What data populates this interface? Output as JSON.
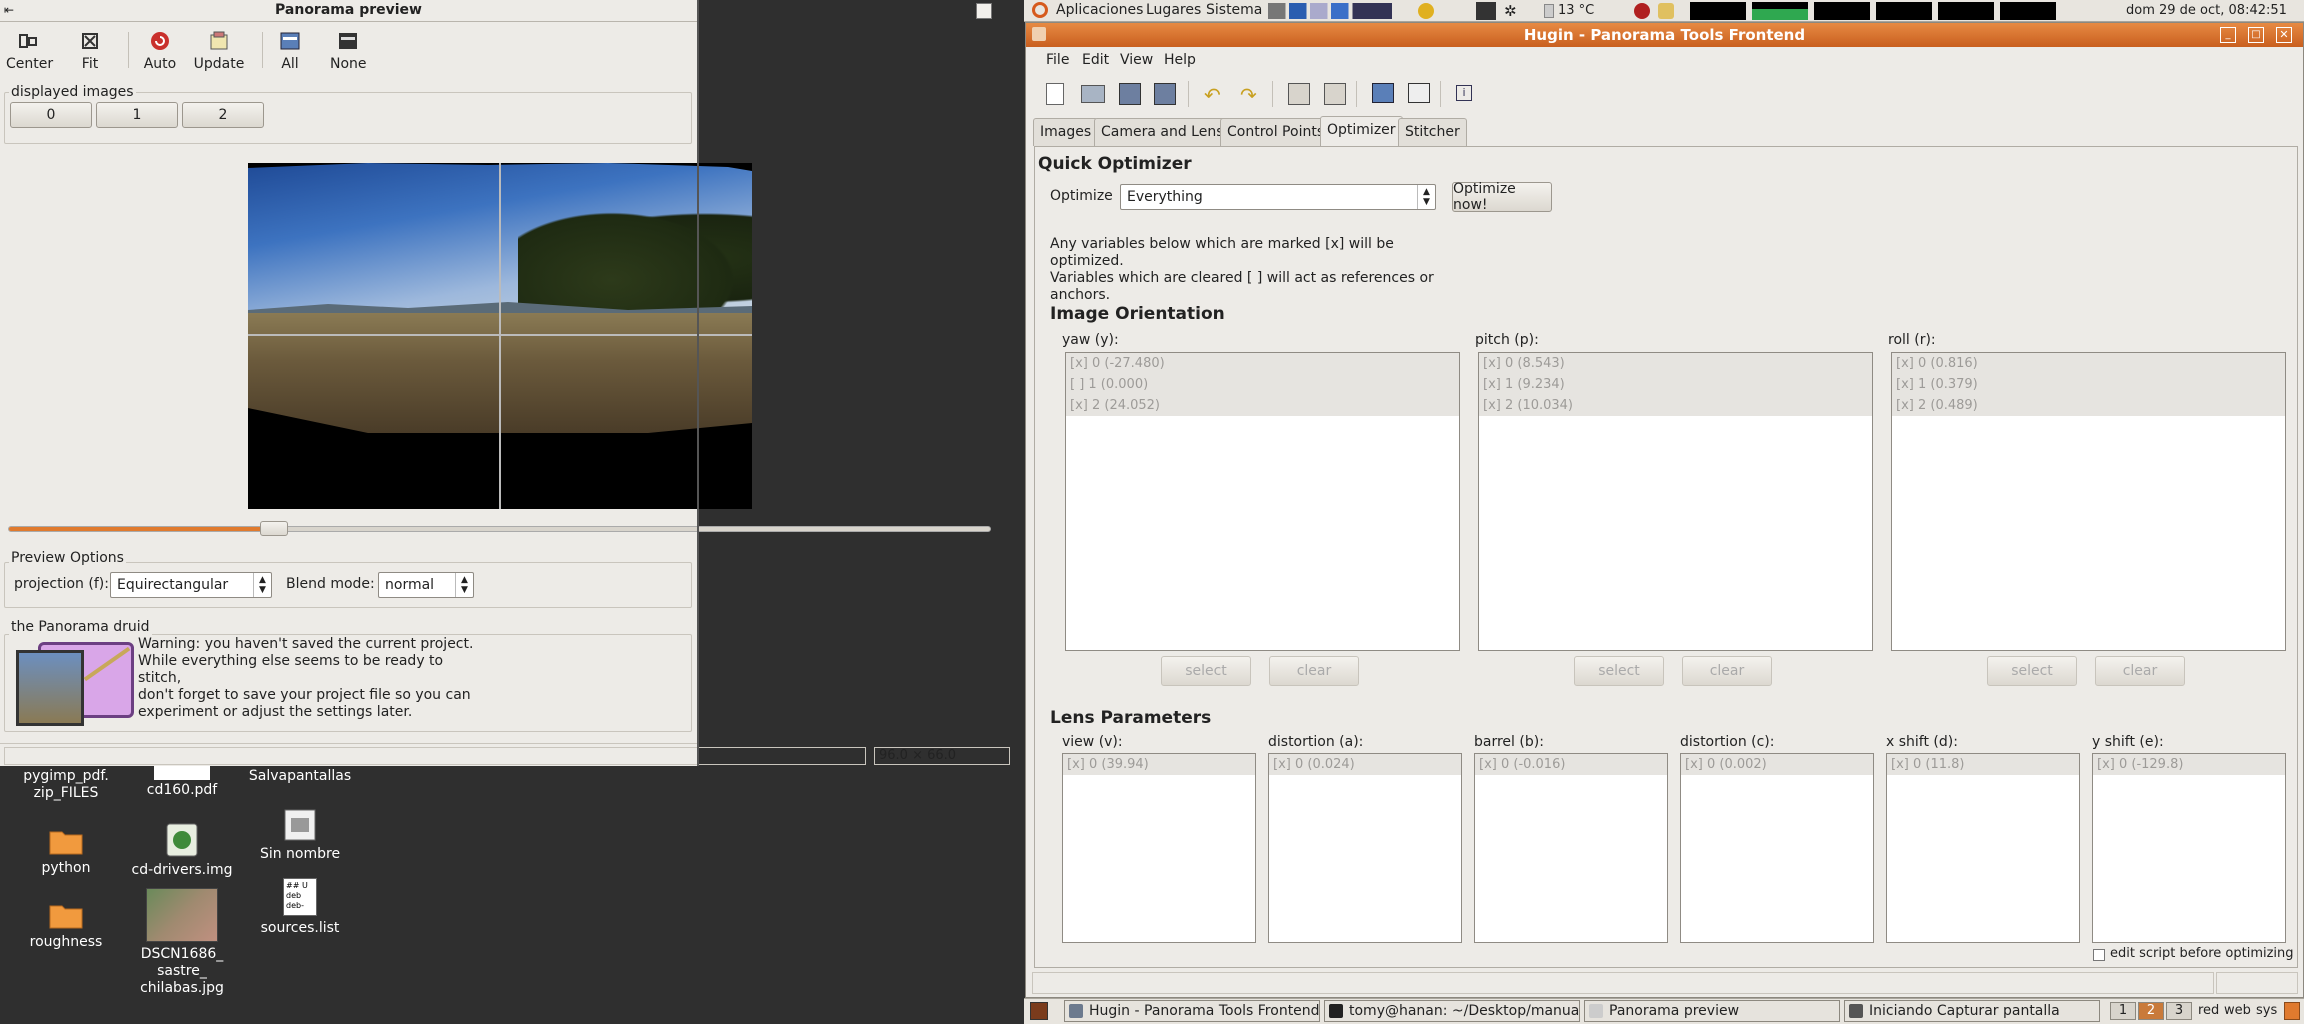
{
  "preview": {
    "title": "Panorama preview",
    "toolbar": [
      {
        "label": "Center",
        "icon": "center-icon"
      },
      {
        "label": "Fit",
        "icon": "fit-icon"
      },
      {
        "label": "Auto",
        "icon": "auto-icon"
      },
      {
        "label": "Update",
        "icon": "update-icon"
      },
      {
        "label": "All",
        "icon": "all-icon"
      },
      {
        "label": "None",
        "icon": "none-icon"
      }
    ],
    "displayed_images_label": "displayed images",
    "image_buttons": [
      "0",
      "1",
      "2"
    ],
    "slider_value_percent": 27,
    "preview_options_label": "Preview Options",
    "projection_label": "projection (f):",
    "projection_value": "Equirectangular",
    "blend_label": "Blend mode:",
    "blend_value": "normal",
    "druid_label": "the Panorama druid",
    "druid_text": "Warning:  you haven't saved the current project.\nWhile everything else seems to be ready to stitch,\ndon't forget to save your project file so you can\nexperiment or adjust the settings later.",
    "status_fov": "96.0 × 66.0"
  },
  "desktop": {
    "icons": [
      {
        "label": "pygimp_pdf.\nzip_FILES",
        "kind": "none"
      },
      {
        "label": "cd160.pdf",
        "kind": "file"
      },
      {
        "label": "Salvapantallas",
        "kind": "none"
      },
      {
        "label": "python",
        "kind": "folder"
      },
      {
        "label": "cd-drivers.img",
        "kind": "disk"
      },
      {
        "label": "Sin nombre",
        "kind": "image"
      },
      {
        "label": "roughness",
        "kind": "folder"
      },
      {
        "label": "DSCN1686_\nsastre_\nchilabas.jpg",
        "kind": "photo"
      },
      {
        "label": "sources.list",
        "kind": "text"
      }
    ],
    "sources_icon_text": "## U\ndeb\ndeb-"
  },
  "top_panel": {
    "menus": [
      "Aplicaciones",
      "Lugares",
      "Sistema"
    ],
    "temperature": "13 °C",
    "clock": "dom 29 de oct, 08:42:51"
  },
  "hugin": {
    "title": "Hugin - Panorama Tools Frontend",
    "menus": [
      "File",
      "Edit",
      "View",
      "Help"
    ],
    "tabs": [
      "Images",
      "Camera and Lens",
      "Control Points",
      "Optimizer",
      "Stitcher"
    ],
    "active_tab": "Optimizer",
    "quick_optimizer": "Quick Optimizer",
    "optimize_label": "Optimize",
    "optimize_value": "Everything",
    "optimize_now": "Optimize now!",
    "info": "Any variables below which are marked [x] will be optimized.\nVariables which are cleared [ ] will act as references or\nanchors.",
    "image_orientation": "Image Orientation",
    "orientation": [
      {
        "label": "yaw (y):",
        "rows": [
          "[x] 0 (-27.480)",
          "[ ] 1 (0.000)",
          "[x] 2 (24.052)"
        ]
      },
      {
        "label": "pitch (p):",
        "rows": [
          "[x] 0 (8.543)",
          "[x] 1 (9.234)",
          "[x] 2 (10.034)"
        ]
      },
      {
        "label": "roll (r):",
        "rows": [
          "[x] 0 (0.816)",
          "[x] 1 (0.379)",
          "[x] 2 (0.489)"
        ]
      }
    ],
    "select_label": "select",
    "clear_label": "clear",
    "lens_parameters": "Lens Parameters",
    "lens": [
      {
        "label": "view (v):",
        "row": "[x] 0 (39.94)"
      },
      {
        "label": "distortion (a):",
        "row": "[x] 0 (0.024)"
      },
      {
        "label": "barrel (b):",
        "row": "[x] 0 (-0.016)"
      },
      {
        "label": "distortion (c):",
        "row": "[x] 0 (0.002)"
      },
      {
        "label": "x shift (d):",
        "row": "[x] 0 (11.8)"
      },
      {
        "label": "y shift (e):",
        "row": "[x] 0 (-129.8)"
      }
    ],
    "edit_script_label": "edit script before optimizing"
  },
  "taskbar": {
    "tasks": [
      "Hugin - Panorama Tools Frontend",
      "tomy@hanan: ~/Desktop/manua...",
      "Panorama preview",
      "Iniciando Capturar pantalla"
    ],
    "workspaces": [
      "1",
      "2",
      "3"
    ],
    "active_workspace": "2",
    "tray": [
      "red",
      "web",
      "sys"
    ]
  },
  "colors": {
    "accent": "#e07a2e",
    "window_bg": "#edebe7",
    "hugin_title": "#d46b2a"
  }
}
